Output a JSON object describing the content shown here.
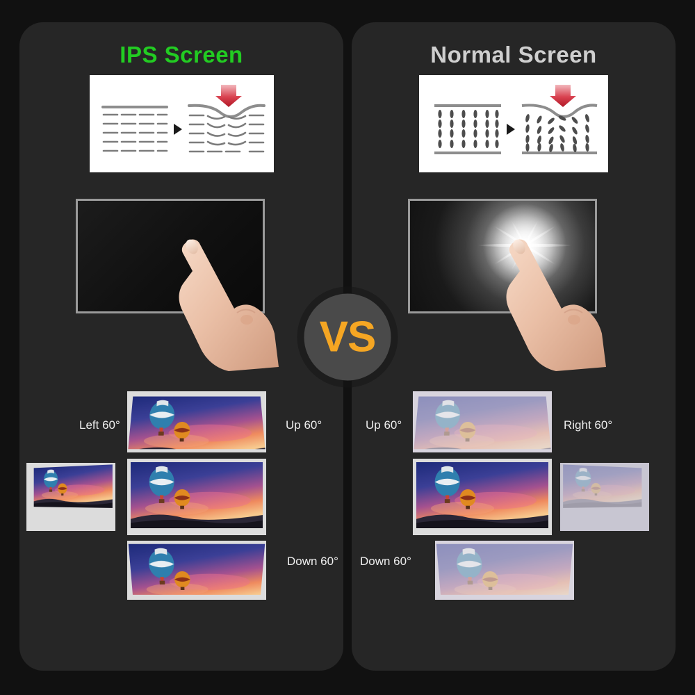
{
  "page": {
    "background": "#111111",
    "card_background": "#262626"
  },
  "center": {
    "badge_text": "VS",
    "badge_color": "#f5a623",
    "badge_bg": "#4a4a4a"
  },
  "panels": [
    {
      "id": "ips",
      "title": "IPS Screen",
      "title_color": "#22cc22",
      "pressure_diagram": {
        "name": "ips-liquid-crystal-pressure-diagram",
        "before_state": "horizontal-aligned-crystals",
        "after_state": "smooth-uniform-bend",
        "arrow_glyph": "right-triangle",
        "pressure_arrow_color": "#cc2233"
      },
      "touch_demo": {
        "name": "ips-touch-pressure-demo",
        "screen_state": "no-bloom-uniform-dark",
        "hand": "pointing-finger"
      },
      "angles": [
        {
          "label": "Left 60°",
          "position": "left",
          "washed_out": false
        },
        {
          "label": "Up 60°",
          "position": "top",
          "washed_out": false
        },
        {
          "label": "Down 60°",
          "position": "bottom",
          "washed_out": false
        }
      ],
      "center_reference": "full-color-balloon-image"
    },
    {
      "id": "normal",
      "title": "Normal Screen",
      "title_color": "#cfcfcf",
      "pressure_diagram": {
        "name": "normal-liquid-crystal-pressure-diagram",
        "before_state": "vertical-aligned-crystals",
        "after_state": "scattered-chaotic-crystals",
        "arrow_glyph": "right-triangle",
        "pressure_arrow_color": "#cc2233"
      },
      "touch_demo": {
        "name": "normal-touch-pressure-demo",
        "screen_state": "white-starburst-bloom",
        "hand": "pointing-finger"
      },
      "angles": [
        {
          "label": "Up 60°",
          "position": "top",
          "washed_out": true
        },
        {
          "label": "Right 60°",
          "position": "right",
          "washed_out": true
        },
        {
          "label": "Down 60°",
          "position": "bottom",
          "washed_out": true
        }
      ],
      "center_reference": "full-color-balloon-image"
    }
  ]
}
